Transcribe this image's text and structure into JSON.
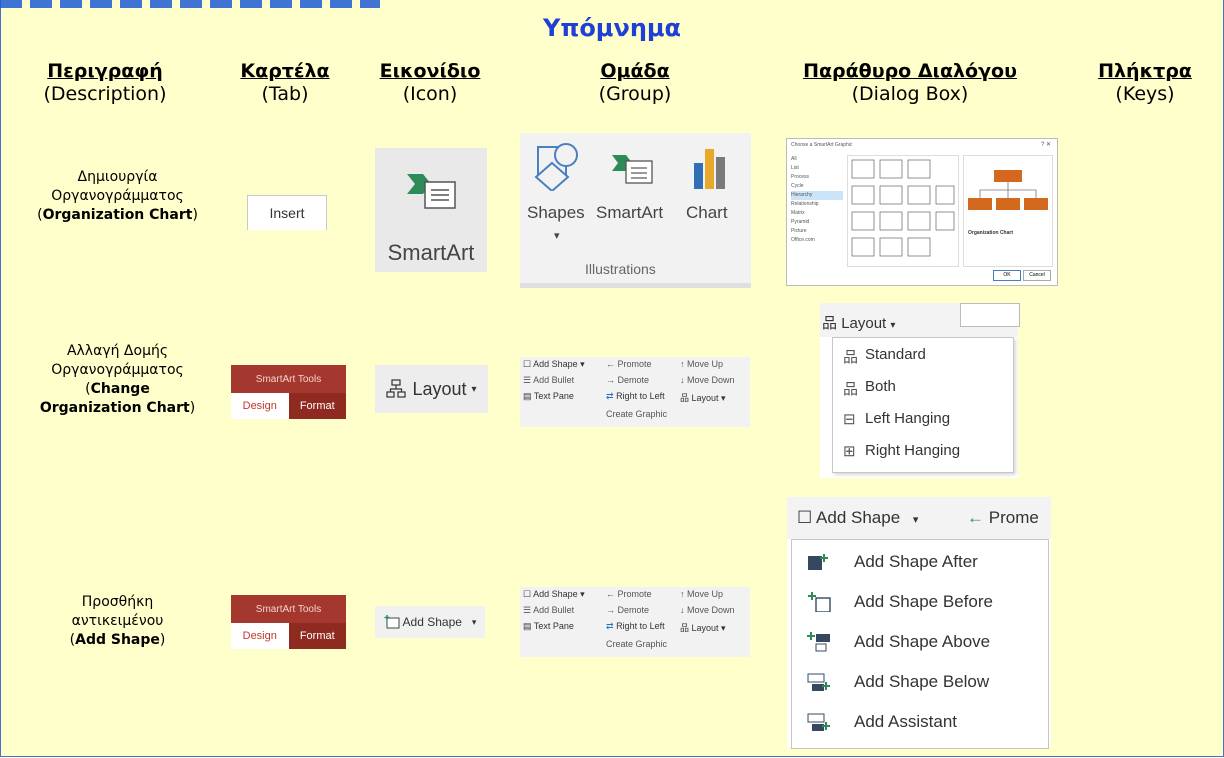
{
  "legend_title": "Υπόμνημα",
  "headers": [
    {
      "gr": "Περιγραφή",
      "en": "(Description)"
    },
    {
      "gr": "Καρτέλα",
      "en": "(Tab)"
    },
    {
      "gr": "Εικονίδιο",
      "en": "(Icon)"
    },
    {
      "gr": "Ομάδα",
      "en": "(Group)"
    },
    {
      "gr": "Παράθυρο Διαλόγου",
      "en": "(Dialog Box)"
    },
    {
      "gr": "Πλήκτρα",
      "en": "(Keys)"
    }
  ],
  "rows": [
    {
      "desc_1": "Δημιουργία",
      "desc_2": "Οργανογράμματος",
      "desc_open": "(",
      "desc_bold": "Organization Chart",
      "desc_close": ")"
    },
    {
      "desc_1": "Αλλαγή Δομής",
      "desc_2": "Οργανογράμματος",
      "desc_open": "(",
      "desc_bold": "Change Organization Chart",
      "desc_close": ")"
    },
    {
      "desc_1": "Προσθήκη",
      "desc_2": "αντικειμένου",
      "desc_open": "(",
      "desc_bold": "Add Shape",
      "desc_close": ")"
    }
  ],
  "tabs": {
    "insert": "Insert",
    "smartart_tools": "SmartArt Tools",
    "design": "Design",
    "format": "Format"
  },
  "icons": {
    "smartart": "SmartArt",
    "layout": "Layout",
    "add_shape": "Add Shape"
  },
  "illustrations": {
    "shapes": "Shapes",
    "smartart": "SmartArt",
    "chart": "Chart",
    "group_label": "Illustrations"
  },
  "create_graphic": {
    "add_shape": "Add Shape",
    "add_bullet": "Add Bullet",
    "text_pane": "Text Pane",
    "promote": "Promote",
    "demote": "Demote",
    "right_to_left": "Right to Left",
    "move_up": "Move Up",
    "move_down": "Move Down",
    "layout": "Layout",
    "group_label": "Create Graphic"
  },
  "dialog": {
    "title": "Choose a SmartArt Graphic",
    "categories": [
      "All",
      "List",
      "Process",
      "Cycle",
      "Hierarchy",
      "Relationship",
      "Matrix",
      "Pyramid",
      "Picture",
      "Office.com"
    ],
    "ok": "OK",
    "cancel": "Cancel",
    "preview_title": "Organization Chart"
  },
  "layout_menu": {
    "button": "Layout",
    "items": [
      "Standard",
      "Both",
      "Left Hanging",
      "Right Hanging"
    ]
  },
  "add_menu": {
    "button": "Add Shape",
    "promote": "Prome",
    "items": [
      "Add Shape After",
      "Add Shape Before",
      "Add Shape Above",
      "Add Shape Below",
      "Add Assistant"
    ]
  }
}
